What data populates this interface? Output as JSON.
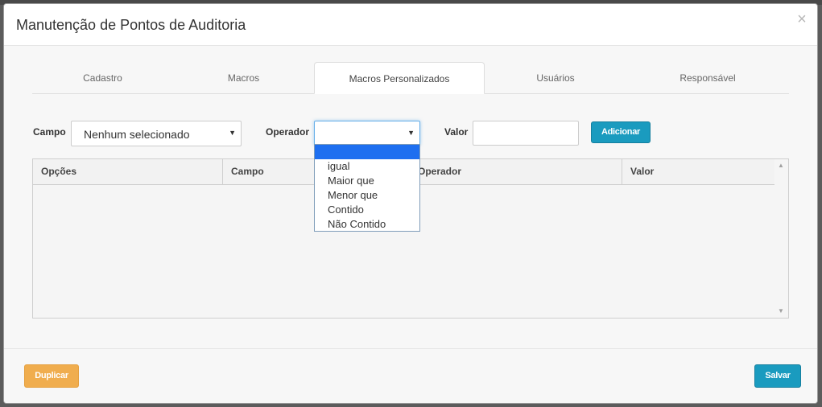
{
  "modal": {
    "title": "Manutenção de Pontos de Auditoria",
    "close_glyph": "×"
  },
  "tabs": [
    {
      "label": "Cadastro",
      "active": false
    },
    {
      "label": "Macros",
      "active": false
    },
    {
      "label": "Macros Personalizados",
      "active": true
    },
    {
      "label": "Usuários",
      "active": false
    },
    {
      "label": "Responsável",
      "active": false
    }
  ],
  "form": {
    "campo_label": "Campo",
    "campo_value": "Nenhum selecionado",
    "operador_label": "Operador",
    "operador_value": "",
    "valor_label": "Valor",
    "valor_value": "",
    "add_button": "Adicionar"
  },
  "dropdown": {
    "options": [
      "",
      "igual",
      "Maior que",
      "Menor que",
      "Contido",
      "Não Contido"
    ],
    "selected_index": 0
  },
  "grid": {
    "columns": [
      "Opções",
      "Campo",
      "Operador",
      "Valor"
    ],
    "rows": []
  },
  "footer": {
    "duplicate_button": "Duplicar",
    "save_button": "Salvar"
  },
  "icons": {
    "caret": "caret-down-icon",
    "scroll_up": "scroll-up-icon",
    "scroll_down": "scroll-down-icon",
    "close": "close-icon"
  },
  "colors": {
    "info": "#1a9bbf",
    "warning": "#f0ad4e",
    "selected_option": "#1e6ff0"
  }
}
